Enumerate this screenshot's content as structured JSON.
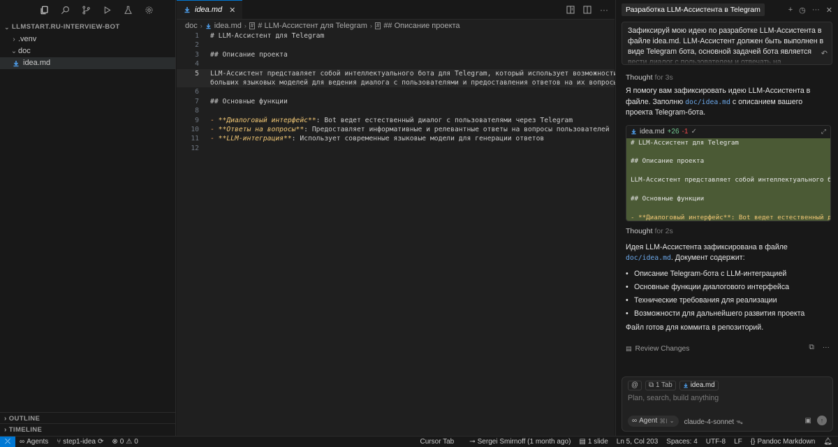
{
  "sidebar": {
    "root_label": "LLMSTART.RU-INTERVIEW-BOT",
    "tree": [
      {
        "label": ".venv",
        "chevron": "›"
      },
      {
        "label": "doc",
        "chevron": "⌄"
      },
      {
        "label": "idea.md",
        "chevron": ""
      }
    ],
    "outline_label": "OUTLINE",
    "timeline_label": "TIMELINE"
  },
  "editor": {
    "tab_label": "idea.md",
    "breadcrumbs": [
      "doc",
      "idea.md",
      "# LLM-Ассистент для Telegram",
      "## Описание проекта"
    ],
    "current_line": 5,
    "lines": [
      {
        "n": "1",
        "text": "# LLM-Ассистент для Telegram"
      },
      {
        "n": "2",
        "text": ""
      },
      {
        "n": "3",
        "text": "## Описание проекта"
      },
      {
        "n": "4",
        "text": ""
      },
      {
        "n": "5",
        "text": "LLM-Ассистент представляет собой интеллектуального бота для Telegram, который использует возможности"
      },
      {
        "n": "",
        "text": "больших языковых моделей для ведения диалога с пользователями и предоставления ответов на их вопросы."
      },
      {
        "n": "6",
        "text": ""
      },
      {
        "n": "7",
        "text": "## Основные функции"
      },
      {
        "n": "8",
        "text": ""
      },
      {
        "n": "9",
        "dash": "- ",
        "bold": "**Диалоговый интерфейс**",
        "text": ": Bot ведет естественный диалог с пользователями через Telegram"
      },
      {
        "n": "10",
        "dash": "- ",
        "bold": "**Ответы на вопросы**",
        "text": ": Предоставляет информативные и релевантные ответы на вопросы пользователей"
      },
      {
        "n": "11",
        "dash": "- ",
        "bold": "**LLM-интеграция**",
        "text": ": Использует современные языковые модели для генерации ответов"
      },
      {
        "n": "12",
        "text": ""
      }
    ]
  },
  "chat": {
    "title": "Разработка LLM-Ассистента в Telegram",
    "user_message": "Зафиксируй мою идею по разработке LLM-Ассистента в файле idea.md. LLM-Ассистент должен быть выполнен в виде Telegram бота, основной задачей бота является вести диалог с пользователем и отвечать на",
    "thought1_label": "Thought",
    "thought1_time": "for 3s",
    "reply1_pre": "Я помогу вам зафиксировать идею LLM-Ассистента в файле. Заполню ",
    "reply1_code": "doc/idea.md",
    "reply1_post": " с описанием вашего проекта Telegram-бота.",
    "diff": {
      "file": "idea.md",
      "added": "+26",
      "removed": "-1",
      "lines": [
        "# LLM-Ассистент для Telegram",
        "",
        "## Описание проекта",
        "",
        "LLM-Ассистент представляет собой интеллектуального бо",
        "",
        "## Основные функции",
        "",
        "- **Диалоговый интерфейс**: Bot ведет естественный ди"
      ]
    },
    "thought2_label": "Thought",
    "thought2_time": "for 2s",
    "reply2_pre": "Идея LLM-Ассистента зафиксирована в файле ",
    "reply2_code": "doc/idea.md",
    "reply2_post": ". Документ содержит:",
    "bullets": [
      "Описание Telegram-бота с LLM-интеграцией",
      "Основные функции диалогового интерфейса",
      "Технические требования для реализации",
      "Возможности для дальнейшего развития проекта"
    ],
    "reply3": "Файл готов для коммита в репозиторий.",
    "review_label": "Review Changes",
    "composer": {
      "at": "@",
      "tab_chip": "1 Tab",
      "file_chip": "idea.md",
      "placeholder": "Plan, search, build anything",
      "agent_label": "Agent",
      "agent_kbd": "⌘I",
      "model": "claude-4-sonnet"
    }
  },
  "status": {
    "agents": "Agents",
    "branch": "step1-idea",
    "errors": "0",
    "warnings": "0",
    "cursor_tab": "Cursor Tab",
    "blame": "Sergei Smirnoff (1 month ago)",
    "slide": "1 slide",
    "position": "Ln 5, Col 203",
    "spaces": "Spaces: 4",
    "encoding": "UTF-8",
    "eol": "LF",
    "language": "Pandoc Markdown"
  }
}
